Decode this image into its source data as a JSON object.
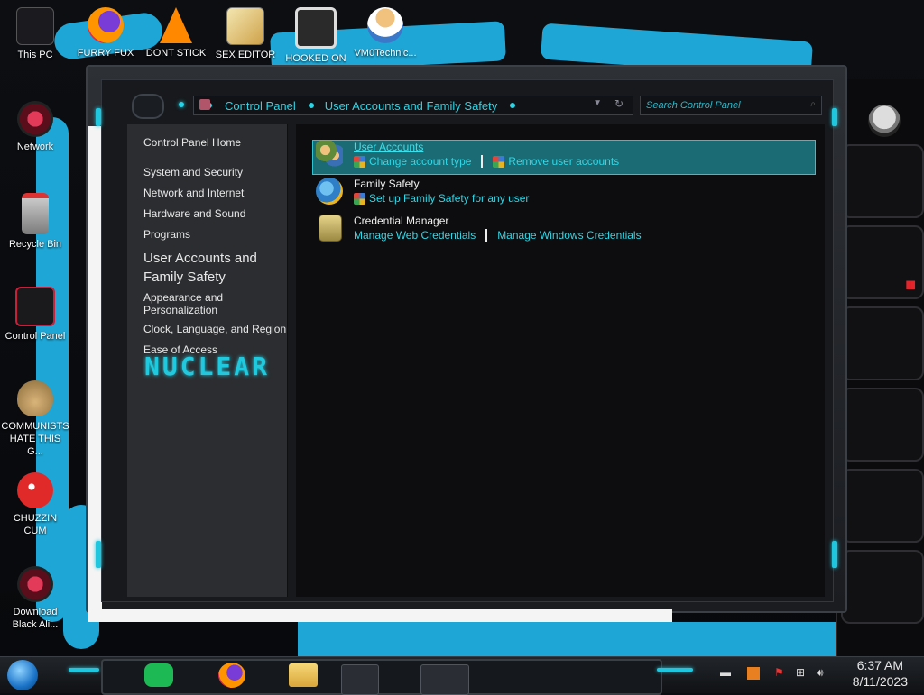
{
  "desktop": {
    "icons": [
      {
        "label": "This PC"
      },
      {
        "label": "FURRY FUX"
      },
      {
        "label": "DONT STICK"
      },
      {
        "label": "SEX EDITOR"
      },
      {
        "label": "HOOKED ON"
      },
      {
        "label": "VM0Technic..."
      },
      {
        "label": "Network"
      },
      {
        "label": "Recycle Bin"
      },
      {
        "label": "Control Panel"
      },
      {
        "label": "COMMUNISTS HATE THIS G..."
      },
      {
        "label": "CHUZZIN CUM"
      },
      {
        "label": "Download Black Ali..."
      }
    ]
  },
  "window": {
    "address": {
      "crumbs": [
        "Control Panel",
        "User Accounts and Family Safety"
      ]
    },
    "search": {
      "placeholder": "Search Control Panel"
    },
    "leftnav": {
      "home": "Control Panel Home",
      "items": [
        "System and Security",
        "Network and Internet",
        "Hardware and Sound",
        "Programs",
        "User Accounts and Family Safety",
        "Appearance and Personalization",
        "Clock, Language, and Region",
        "Ease of Access"
      ],
      "logo_text": "NUCLEAR"
    },
    "categories": [
      {
        "title": "User Accounts",
        "links": [
          "Change account type",
          "Remove user accounts"
        ]
      },
      {
        "title": "Family Safety",
        "links": [
          "Set up Family Safety for any user"
        ]
      },
      {
        "title": "Credential Manager",
        "links": [
          "Manage Web Credentials",
          "Manage Windows Credentials"
        ]
      }
    ]
  },
  "taskbar": {
    "clock": {
      "time": "6:37 AM",
      "date": "8/11/2023"
    }
  },
  "colors": {
    "accent_cyan": "#2fd3e3",
    "highlight": "#1a6b73",
    "wallpaper_blue": "#1ea7d6",
    "alienware_red": "#e3242b"
  }
}
